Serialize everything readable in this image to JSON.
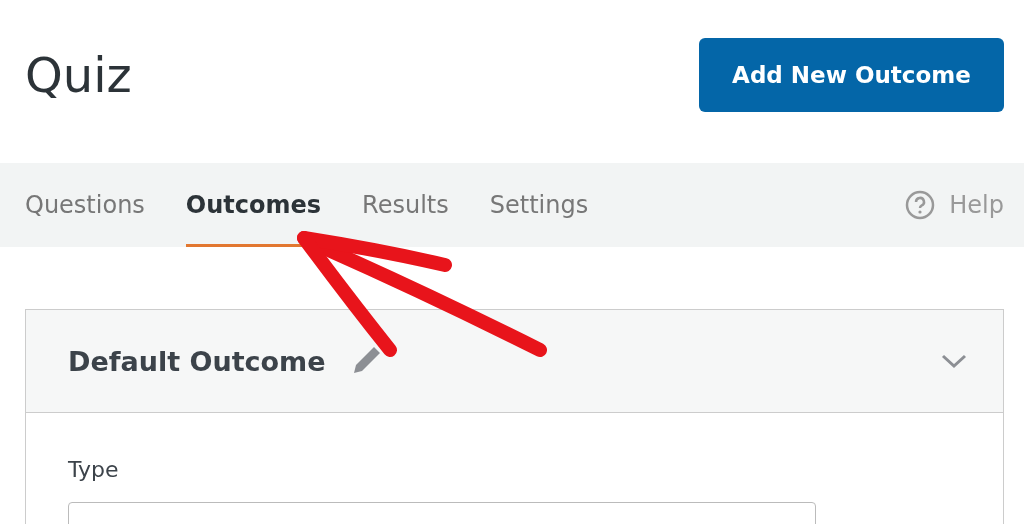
{
  "header": {
    "title": "Quiz",
    "add_button": "Add New Outcome"
  },
  "tabs": [
    {
      "label": "Questions",
      "selected": false
    },
    {
      "label": "Outcomes",
      "selected": true
    },
    {
      "label": "Results",
      "selected": false
    },
    {
      "label": "Settings",
      "selected": false
    }
  ],
  "help": {
    "label": "Help"
  },
  "outcome_panel": {
    "title": "Default Outcome",
    "expanded": true,
    "type_label": "Type"
  }
}
